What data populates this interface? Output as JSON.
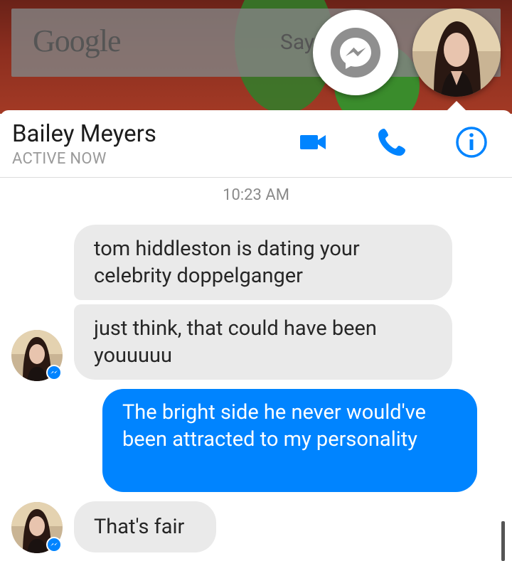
{
  "background": {
    "google_logo": "Google",
    "search_hint": "Say"
  },
  "chat_head": {
    "icon": "messenger-icon",
    "avatar_icon": "profile-photo"
  },
  "header": {
    "contact_name": "Bailey Meyers",
    "status": "ACTIVE NOW",
    "actions": [
      "video-call-icon",
      "phone-call-icon",
      "info-icon"
    ],
    "accent_color": "#0084ff"
  },
  "conversation": {
    "timestamp": "10:23 AM",
    "messages": [
      {
        "from": "them",
        "text": "tom hiddleston is dating your celebrity doppelganger"
      },
      {
        "from": "them",
        "text": "just think, that could have been youuuuu"
      },
      {
        "from": "me",
        "text": "The bright side he never would've been attracted to my personality"
      },
      {
        "from": "them",
        "text": "That's fair"
      }
    ]
  },
  "colors": {
    "incoming_bubble": "#eaeaea",
    "outgoing_bubble": "#0084ff"
  }
}
